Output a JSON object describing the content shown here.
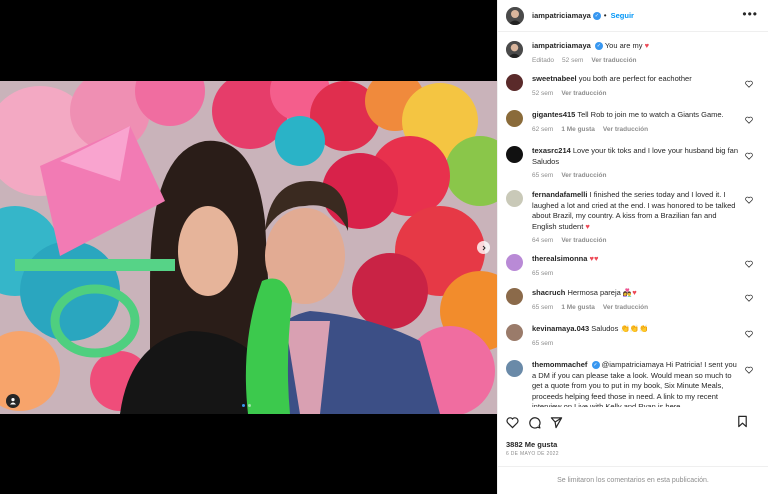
{
  "post": {
    "author": "iampatriciamaya",
    "follow_label": "Seguir",
    "more_label": "•••",
    "caption_text": "You are my",
    "caption_meta": {
      "status": "Editado",
      "time": "52 sem",
      "translate": "Ver traducción"
    },
    "likes": "3882 Me gusta",
    "date": "6 DE MAYO DE 2022",
    "comments_disabled": "Se limitaron los comentarios en esta publicación."
  },
  "comments": [
    {
      "user": "sweetnabeel",
      "text": "you both are perfect for eachother",
      "time": "52 sem",
      "likes": "",
      "translate": "Ver traducción"
    },
    {
      "user": "gigantes415",
      "text": "Tell Rob to join me to watch a Giants Game.",
      "time": "62 sem",
      "likes": "1 Me gusta",
      "translate": "Ver traducción"
    },
    {
      "user": "texasrc214",
      "text": "Love your tik toks and I love your husband big fan Saludos",
      "time": "65 sem",
      "likes": "",
      "translate": "Ver traducción"
    },
    {
      "user": "fernandafamelli",
      "text": "I finished the series today and I loved it. I laughed a lot and cried at the end. I was honored to be talked about Brazil, my country. A kiss from a Brazilian fan and English student",
      "time": "64 sem",
      "likes": "",
      "translate": "Ver traducción"
    },
    {
      "user": "therealsimonna",
      "text": "",
      "time": "65 sem",
      "likes": "",
      "translate": ""
    },
    {
      "user": "shacruch",
      "text": "Hermosa pareja",
      "time": "65 sem",
      "likes": "1 Me gusta",
      "translate": "Ver traducción"
    },
    {
      "user": "kevinamaya.043",
      "text": "Saludos",
      "time": "65 sem",
      "likes": "",
      "translate": ""
    },
    {
      "user": "themommachef",
      "text": "@iampatriciamaya Hi Patricia! I sent you a DM if you can please take a look. Would mean so much to get a quote from you to put in my book, Six Minute Meals, proceeds helping feed those in need. A link to my recent interview on Live with Kelly and Ryan is here",
      "time": "",
      "likes": "",
      "translate": ""
    }
  ],
  "colors": {
    "accent": "#0095f6",
    "verified": "#3897f0",
    "heart": "#ed4956",
    "muted": "#8e8e8e"
  }
}
